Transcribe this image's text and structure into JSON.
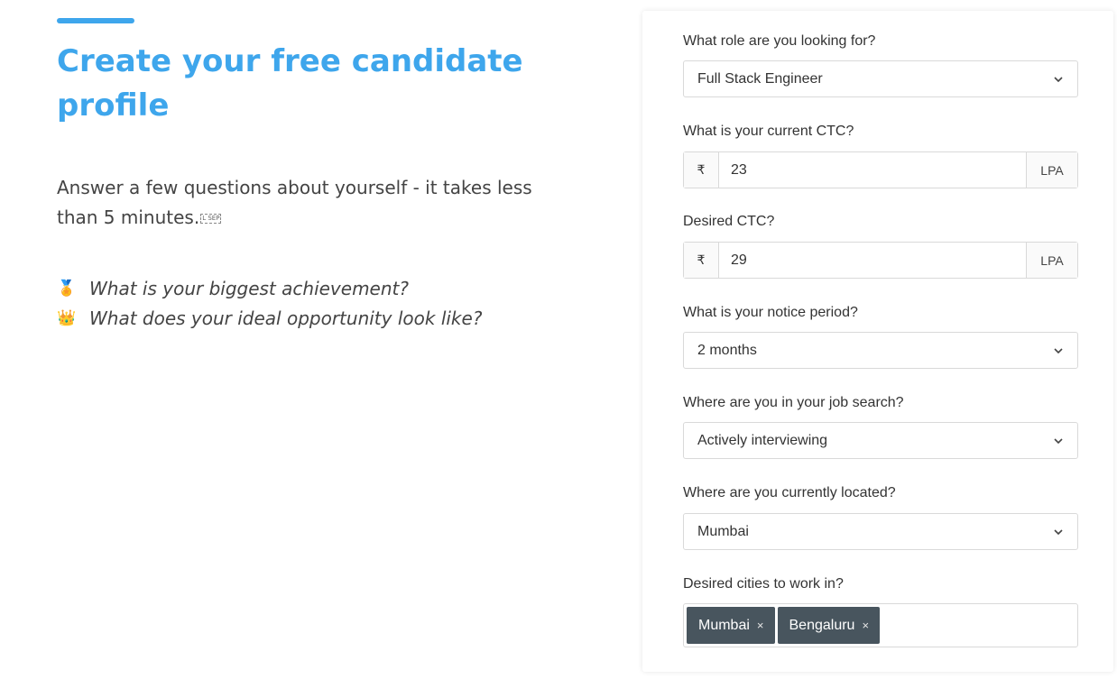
{
  "hero": {
    "title": "Create your free candidate profile",
    "subtitle": "Answer a few questions about yourself - it takes less than 5 minutes.",
    "sep_glyph": "L SEP",
    "questions": [
      {
        "emoji": "🏅",
        "icon": "medal-icon",
        "text": "What is your biggest achievement?"
      },
      {
        "emoji": "👑",
        "icon": "crown-icon",
        "text": "What does your ideal opportunity look like?"
      }
    ]
  },
  "form": {
    "role": {
      "label": "What role are you looking for?",
      "value": "Full Stack Engineer"
    },
    "current_ctc": {
      "label": "What is your current CTC?",
      "prefix": "₹",
      "value": "23",
      "suffix": "LPA"
    },
    "desired_ctc": {
      "label": "Desired CTC?",
      "prefix": "₹",
      "value": "29",
      "suffix": "LPA"
    },
    "notice": {
      "label": "What is your notice period?",
      "value": "2 months"
    },
    "job_search": {
      "label": "Where are you in your job search?",
      "value": "Actively interviewing"
    },
    "location": {
      "label": "Where are you currently located?",
      "value": "Mumbai"
    },
    "cities": {
      "label": "Desired cities to work in?",
      "tags": [
        "Mumbai",
        "Bengaluru"
      ],
      "remove_symbol": "×"
    }
  },
  "colors": {
    "accent": "#3ea6ec",
    "tag_bg": "#48555e"
  }
}
